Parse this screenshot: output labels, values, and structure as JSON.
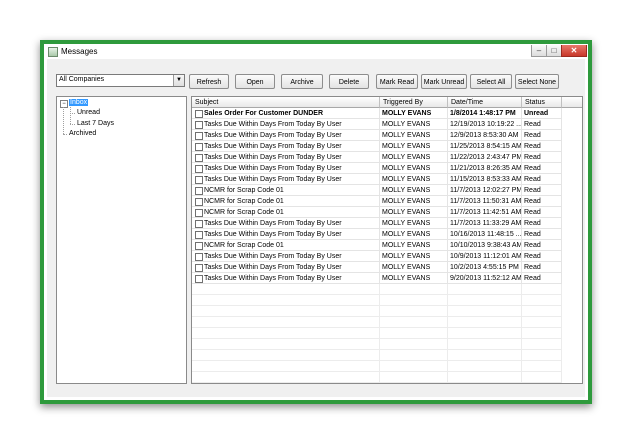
{
  "window": {
    "title": "Messages",
    "icon": "messages-app-icon"
  },
  "filter": {
    "selected": "All Companies"
  },
  "toolbar": {
    "refresh": "Refresh",
    "open": "Open",
    "archive": "Archive",
    "delete": "Delete",
    "mark_read": "Mark Read",
    "mark_unread": "Mark Unread",
    "select_all": "Select All",
    "select_none": "Select None"
  },
  "tree": {
    "inbox": "Inbox",
    "unread": "Unread",
    "last7": "Last 7 Days",
    "archived": "Archived"
  },
  "grid": {
    "columns": {
      "subject": "Subject",
      "triggered_by": "Triggered By",
      "datetime": "Date/Time",
      "status": "Status"
    },
    "rows": [
      {
        "subject": "Sales Order For Customer DUNDER",
        "by": "MOLLY EVANS",
        "date": "1/8/2014 1:48:17 PM",
        "status": "Unread"
      },
      {
        "subject": "Tasks Due Within  Days From Today By User",
        "by": "MOLLY EVANS",
        "date": "12/19/2013 10:19:22 ...",
        "status": "Read"
      },
      {
        "subject": "Tasks Due Within  Days From Today By User",
        "by": "MOLLY EVANS",
        "date": "12/9/2013 8:53:30 AM",
        "status": "Read"
      },
      {
        "subject": "Tasks Due Within  Days From Today By User",
        "by": "MOLLY EVANS",
        "date": "11/25/2013 8:54:15 AM",
        "status": "Read"
      },
      {
        "subject": "Tasks Due Within  Days From Today By User",
        "by": "MOLLY EVANS",
        "date": "11/22/2013 2:43:47 PM",
        "status": "Read"
      },
      {
        "subject": "Tasks Due Within  Days From Today By User",
        "by": "MOLLY EVANS",
        "date": "11/21/2013 8:26:35 AM",
        "status": "Read"
      },
      {
        "subject": "Tasks Due Within  Days From Today By User",
        "by": "MOLLY EVANS",
        "date": "11/15/2013 8:53:33 AM",
        "status": "Read"
      },
      {
        "subject": "NCMR for Scrap Code 01",
        "by": "MOLLY EVANS",
        "date": "11/7/2013 12:02:27 PM",
        "status": "Read"
      },
      {
        "subject": "NCMR for Scrap Code 01",
        "by": "MOLLY EVANS",
        "date": "11/7/2013 11:50:31 AM",
        "status": "Read"
      },
      {
        "subject": "NCMR for Scrap Code 01",
        "by": "MOLLY EVANS",
        "date": "11/7/2013 11:42:51 AM",
        "status": "Read"
      },
      {
        "subject": "Tasks Due Within  Days From Today By User",
        "by": "MOLLY EVANS",
        "date": "11/7/2013 11:33:29 AM",
        "status": "Read"
      },
      {
        "subject": "Tasks Due Within  Days From Today By User",
        "by": "MOLLY EVANS",
        "date": "10/16/2013 11:48:15 ...",
        "status": "Read"
      },
      {
        "subject": "NCMR for Scrap Code 01",
        "by": "MOLLY EVANS",
        "date": "10/10/2013 9:38:43 AM",
        "status": "Read"
      },
      {
        "subject": "Tasks Due Within  Days From Today By User",
        "by": "MOLLY EVANS",
        "date": "10/9/2013 11:12:01 AM",
        "status": "Read"
      },
      {
        "subject": "Tasks Due Within  Days From Today By User",
        "by": "MOLLY EVANS",
        "date": "10/2/2013 4:55:15 PM",
        "status": "Read"
      },
      {
        "subject": "Tasks Due Within  Days From Today By User",
        "by": "MOLLY EVANS",
        "date": "9/20/2013 11:52:12 AM",
        "status": "Read"
      }
    ]
  },
  "colors": {
    "frame": "#2e9a3c",
    "selection": "#3399ff",
    "close_button": "#c8382a"
  }
}
